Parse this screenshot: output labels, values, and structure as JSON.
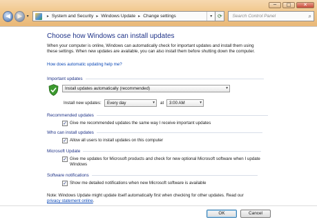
{
  "window": {
    "minimize": "─",
    "maximize": "□",
    "close": "✕"
  },
  "nav": {
    "back_glyph": "◀",
    "forward_glyph": "▶",
    "history_glyph": "▾"
  },
  "address": {
    "breadcrumbs": [
      "System and Security",
      "Windows Update",
      "Change settings"
    ],
    "separator": "▸",
    "dropdown_glyph": "▾",
    "refresh_glyph": "⟳"
  },
  "search": {
    "placeholder": "Search Control Panel",
    "icon_glyph": "⌕"
  },
  "page": {
    "heading": "Choose how Windows can install updates",
    "intro": "When your computer is online, Windows can automatically check for important updates and install them using these settings. When new updates are available, you can also install them before shutting down the computer.",
    "help_link": "How does automatic updating help me?"
  },
  "important": {
    "section": "Important updates",
    "mode": "Install updates automatically (recommended)",
    "install_label": "Install new updates:",
    "day": "Every day",
    "at_label": "at",
    "time": "3:00 AM",
    "arrow": "▾"
  },
  "recommended": {
    "section": "Recommended updates",
    "checkbox": "Give me recommended updates the same way I receive important updates",
    "checked": true
  },
  "who": {
    "section": "Who can install updates",
    "checkbox": "Allow all users to install updates on this computer",
    "checked": true
  },
  "microsoft": {
    "section": "Microsoft Update",
    "checkbox": "Give me updates for Microsoft products and check for new optional Microsoft software when I update Windows",
    "checked": true
  },
  "notifications": {
    "section": "Software notifications",
    "checkbox": "Show me detailed notifications when new Microsoft software is available",
    "checked": true
  },
  "note": {
    "text": "Note: Windows Update might update itself automatically first when checking for other updates.  Read our",
    "link": "privacy statement online",
    "after": "."
  },
  "buttons": {
    "ok": "OK",
    "cancel": "Cancel"
  },
  "check_glyph": "✓",
  "colors": {
    "heading": "#1e3287",
    "link": "#0a47b6",
    "shield": "#3c9a2f"
  }
}
